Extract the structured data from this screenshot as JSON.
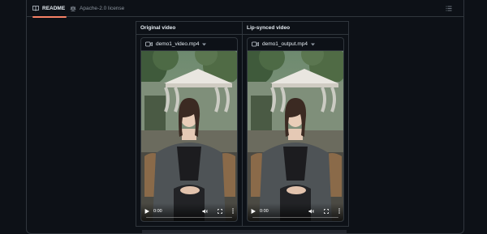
{
  "tabs": [
    {
      "label": "README",
      "icon": "book-icon",
      "active": true
    },
    {
      "label": "Apache-2.0 license",
      "icon": "scale-icon",
      "active": false
    }
  ],
  "outline_icon": "list-icon",
  "colors": {
    "background": "#0d1117",
    "border": "#30363d",
    "tab_underline": "#f78166",
    "text": "#e6edf3",
    "muted": "#8b949e"
  },
  "table": {
    "columns": [
      "Original video",
      "Lip-synced video"
    ],
    "videos": [
      {
        "filename": "demo1_video.mp4",
        "time": "0:00",
        "progress": 0
      },
      {
        "filename": "demo1_output.mp4",
        "time": "0:00",
        "progress": 0
      }
    ]
  }
}
